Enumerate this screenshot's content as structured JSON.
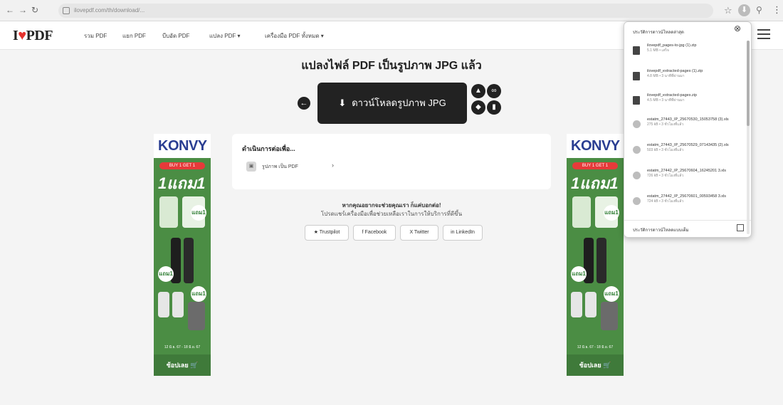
{
  "browser": {
    "back_icon": "arrow-left-icon",
    "forward_icon": "arrow-right-icon",
    "reload_icon": "reload-icon",
    "url": "ilovepdf.com/th/download/...",
    "icons": [
      "star-icon",
      "download-icon",
      "extensions-icon",
      "kebab-icon"
    ]
  },
  "header": {
    "logo_prefix": "I",
    "logo_suffix": "PDF",
    "nav": [
      "รวม PDF",
      "แยก PDF",
      "บีบอัด PDF",
      "แปลง PDF ▾",
      "เครื่องมือ PDF ทั้งหมด ▾"
    ]
  },
  "main": {
    "heading": "แปลงไฟล์ PDF เป็นรูปภาพ JPG แล้ว",
    "download_label": "ดาวน์โหลดรูปภาพ JPG",
    "continue": {
      "title": "ดำเนินการต่อเพื่อ...",
      "item_label": "รูปภาพ เป็น PDF",
      "arrow": "›"
    },
    "share": {
      "title": "หากคุณอยากจะช่วยคุณเรา ก็แค่บอกต่อ!",
      "subtitle": "โปรดแชร์เครื่องมือเพื่อช่วยเหลือเราในการให้บริการที่ดีขึ้น",
      "buttons": [
        "★ Trustpilot",
        "f Facebook",
        "X Twitter",
        "in LinkedIn"
      ]
    }
  },
  "ads": {
    "brand": "KONVY",
    "buy_label": "BUY 1 GET 1",
    "promo": "1แถม1",
    "badge": "แถม1",
    "dates": "12 มิ.ย. 67 - 18 มิ.ย. 67",
    "shop_label": "ช้อปเลย 🛒"
  },
  "downloads": {
    "title": "ประวัติการดาวน์โหลดล่าสุด",
    "items": [
      {
        "name": "ilovepdf_pages-to-jpg (1).zip",
        "meta": "5.1 MB • เสร็จ"
      },
      {
        "name": "ilovepdf_extracted-pages (1).zip",
        "meta": "4.8 MB • 3 นาทีที่ผ่านมา"
      },
      {
        "name": "ilovepdf_extracted-pages.zip",
        "meta": "4.5 MB • 3 นาทีที่ผ่านมา"
      },
      {
        "name": "estatm_27443_IP_25670530_15053758 (3).xls",
        "meta": "275 kB • 3 ชั่วโมงที่แล้ว"
      },
      {
        "name": "estatm_27443_IP_25670529_07143435 (2).xls",
        "meta": "503 kB • 3 ชั่วโมงที่แล้ว"
      },
      {
        "name": "estatm_27442_IP_25670604_16245201 3.xls",
        "meta": "726 kB • 3 ชั่วโมงที่แล้ว"
      },
      {
        "name": "estatm_27442_IP_25670601_00593458 3.xls",
        "meta": "724 kB • 3 ชั่วโมงที่แล้ว"
      }
    ],
    "footer_label": "ประวัติการดาวน์โหลดแบบเต็ม"
  }
}
